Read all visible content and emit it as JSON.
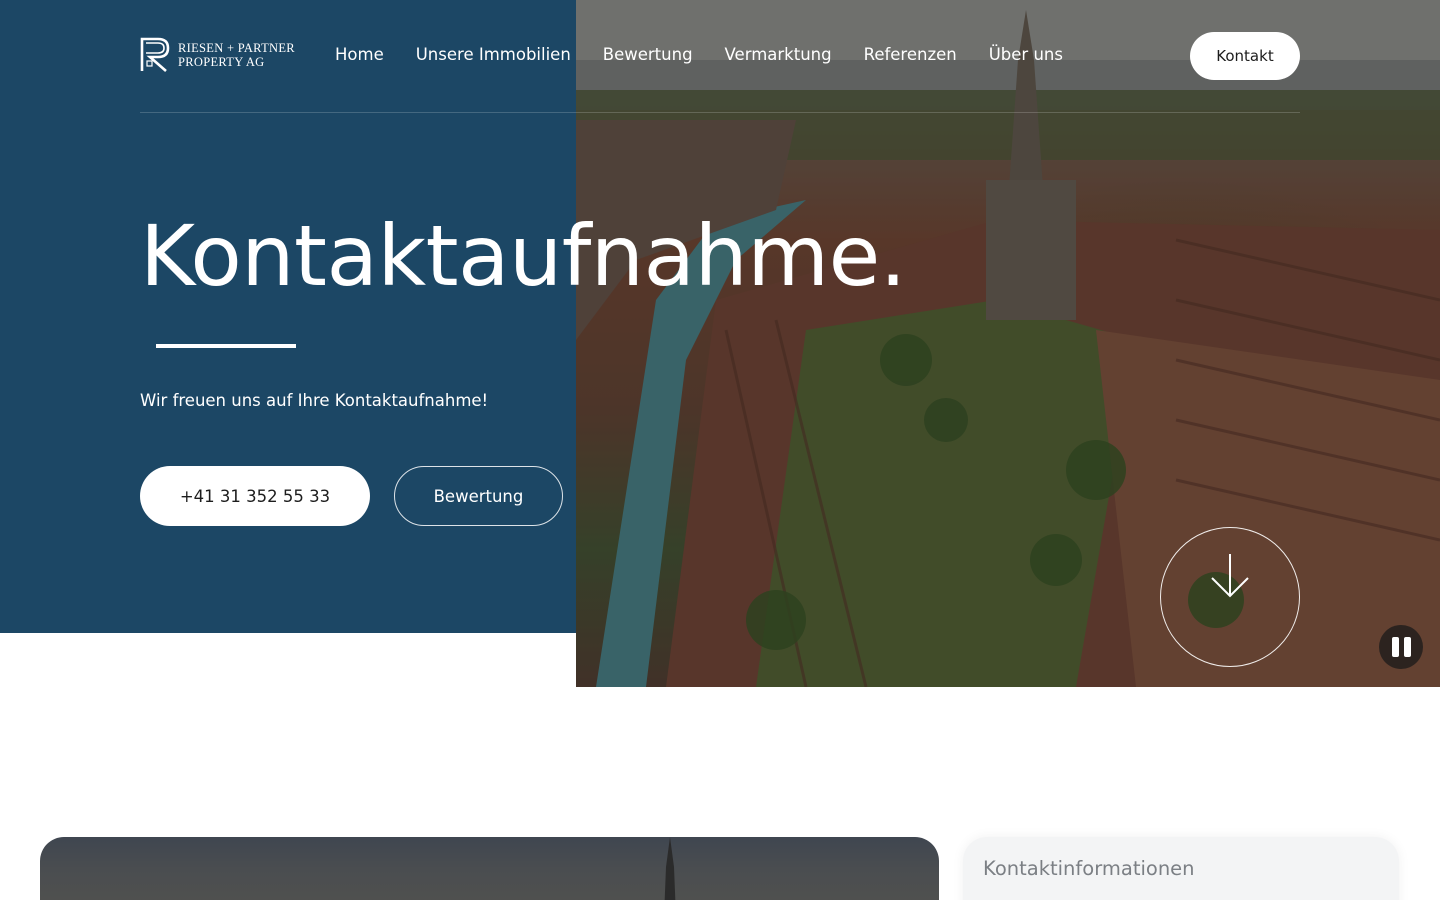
{
  "logo": {
    "line1": "RIESEN + PARTNER",
    "line2": "PROPERTY AG"
  },
  "nav": {
    "items": [
      "Home",
      "Unsere Immobilien",
      "Bewertung",
      "Vermarktung",
      "Referenzen",
      "Über uns"
    ]
  },
  "header": {
    "contact_label": "Kontakt"
  },
  "hero": {
    "title": "Kontaktaufnahme.",
    "subtitle": "Wir freuen uns auf Ihre Kontaktaufnahme!",
    "phone_label": "+41 31 352 55 33",
    "valuation_label": "Bewertung",
    "scroll_icon": "arrow-down-icon",
    "pause_icon": "pause-icon"
  },
  "info_card": {
    "title": "Kontaktinformationen"
  },
  "colors": {
    "panel": "#1c4765",
    "button": "#ffffff"
  }
}
